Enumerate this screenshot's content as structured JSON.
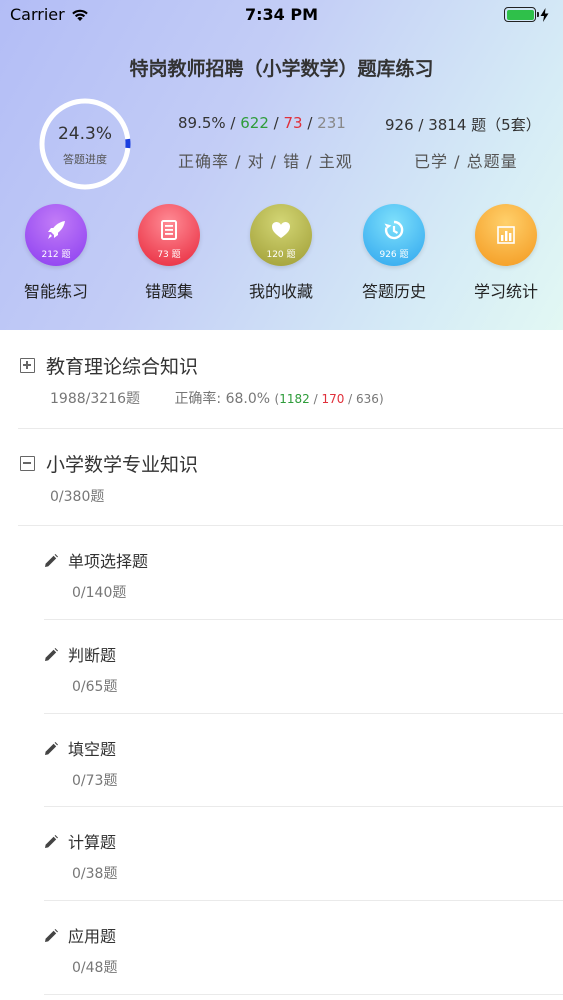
{
  "status_bar": {
    "carrier": "Carrier",
    "time": "7:34 PM"
  },
  "header": {
    "title": "特岗教师招聘（小学数学）题库练习",
    "progress": {
      "percent_text": "24.3%",
      "label": "答题进度",
      "fraction": 0.243
    },
    "accuracy": {
      "rate": "89.5%",
      "correct": "622",
      "wrong": "73",
      "subjective": "231",
      "label": "正确率 / 对 / 错 / 主观"
    },
    "learned": {
      "value": "926 / 3814 题（5套）",
      "label": "已学 / 总题量"
    }
  },
  "actions": [
    {
      "label": "智能练习",
      "count": "212 题",
      "icon": "rocket-icon",
      "color_top": "#c27cf7",
      "color_bottom": "#8a3df0"
    },
    {
      "label": "错题集",
      "count": "73 题",
      "icon": "document-icon",
      "color_top": "#ff8b95",
      "color_bottom": "#e7263a"
    },
    {
      "label": "我的收藏",
      "count": "120 题",
      "icon": "heart-icon",
      "color_top": "#d3d675",
      "color_bottom": "#9e9c34"
    },
    {
      "label": "答题历史",
      "count": "926 题",
      "icon": "history-icon",
      "color_top": "#7ee0fb",
      "color_bottom": "#2ea5ee"
    },
    {
      "label": "学习统计",
      "count": "",
      "icon": "bar-chart-icon",
      "color_top": "#ffd06b",
      "color_bottom": "#f3981e"
    }
  ],
  "sections": [
    {
      "title": "教育理论综合知识",
      "progress": "1988/3216题",
      "accuracy_label": "正确率:",
      "accuracy": "68.0%",
      "correct": "1182",
      "wrong": "170",
      "subjective": "636",
      "expanded": false
    },
    {
      "title": "小学数学专业知识",
      "progress": "0/380题",
      "expanded": true,
      "items": [
        {
          "title": "单项选择题",
          "progress": "0/140题"
        },
        {
          "title": "判断题",
          "progress": "0/65题"
        },
        {
          "title": "填空题",
          "progress": "0/73题"
        },
        {
          "title": "计算题",
          "progress": "0/38题"
        },
        {
          "title": "应用题",
          "progress": "0/48题"
        }
      ]
    }
  ]
}
